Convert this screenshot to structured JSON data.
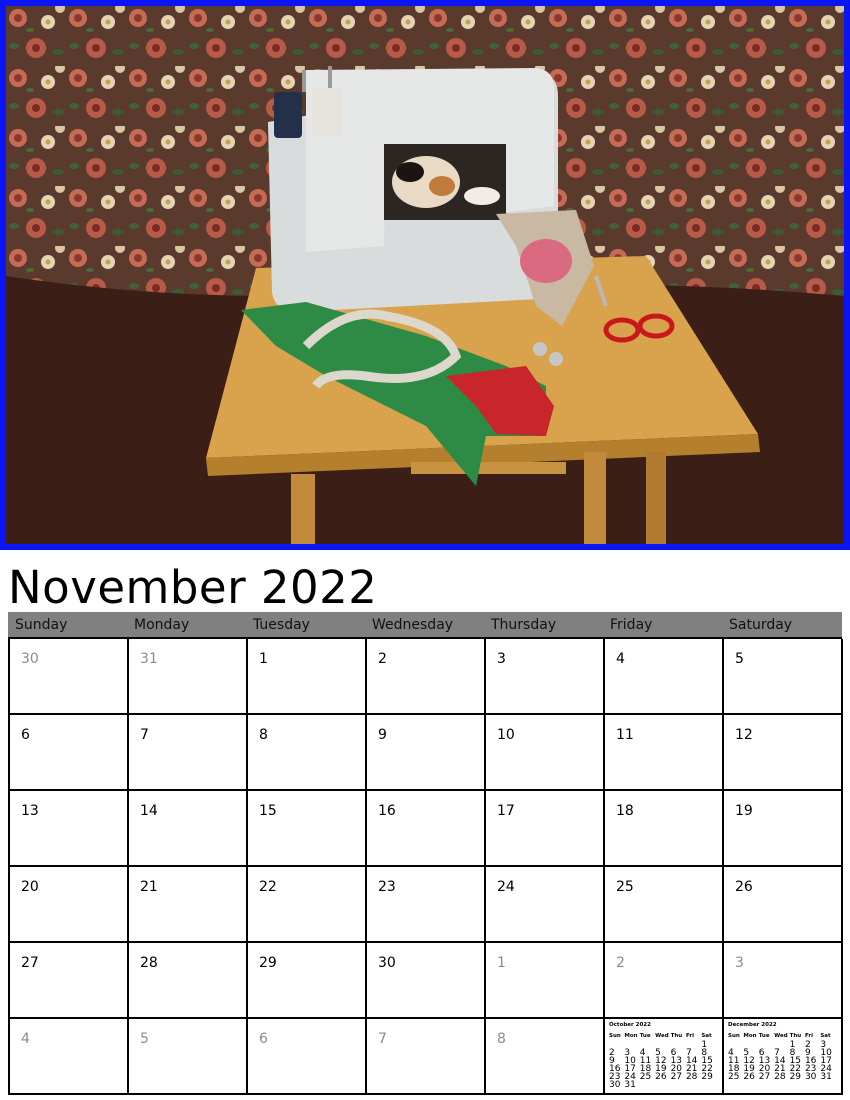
{
  "photo": {
    "frame_color": "#0a14f5"
  },
  "title": "November 2022",
  "weekdays": [
    "Sunday",
    "Monday",
    "Tuesday",
    "Wednesday",
    "Thursday",
    "Friday",
    "Saturday"
  ],
  "days": [
    {
      "label": "30",
      "muted": true
    },
    {
      "label": "31",
      "muted": true
    },
    {
      "label": "1",
      "muted": false
    },
    {
      "label": "2",
      "muted": false
    },
    {
      "label": "3",
      "muted": false
    },
    {
      "label": "4",
      "muted": false
    },
    {
      "label": "5",
      "muted": false
    },
    {
      "label": "6",
      "muted": false
    },
    {
      "label": "7",
      "muted": false
    },
    {
      "label": "8",
      "muted": false
    },
    {
      "label": "9",
      "muted": false
    },
    {
      "label": "10",
      "muted": false
    },
    {
      "label": "11",
      "muted": false
    },
    {
      "label": "12",
      "muted": false
    },
    {
      "label": "13",
      "muted": false
    },
    {
      "label": "14",
      "muted": false
    },
    {
      "label": "15",
      "muted": false
    },
    {
      "label": "16",
      "muted": false
    },
    {
      "label": "17",
      "muted": false
    },
    {
      "label": "18",
      "muted": false
    },
    {
      "label": "19",
      "muted": false
    },
    {
      "label": "20",
      "muted": false
    },
    {
      "label": "21",
      "muted": false
    },
    {
      "label": "22",
      "muted": false
    },
    {
      "label": "23",
      "muted": false
    },
    {
      "label": "24",
      "muted": false
    },
    {
      "label": "25",
      "muted": false
    },
    {
      "label": "26",
      "muted": false
    },
    {
      "label": "27",
      "muted": false
    },
    {
      "label": "28",
      "muted": false
    },
    {
      "label": "29",
      "muted": false
    },
    {
      "label": "30",
      "muted": false
    },
    {
      "label": "1",
      "muted": true
    },
    {
      "label": "2",
      "muted": true
    },
    {
      "label": "3",
      "muted": true
    },
    {
      "label": "4",
      "muted": true
    },
    {
      "label": "5",
      "muted": true
    },
    {
      "label": "6",
      "muted": true
    },
    {
      "label": "7",
      "muted": true
    },
    {
      "label": "8",
      "muted": true
    },
    {
      "mini": "prev"
    },
    {
      "mini": "next"
    }
  ],
  "mini_prev": {
    "title": "October 2022",
    "headers": [
      "Sun",
      "Mon",
      "Tue",
      "Wed",
      "Thu",
      "Fri",
      "Sat"
    ],
    "cells": [
      "",
      "",
      "",
      "",
      "",
      "",
      "1",
      "2",
      "3",
      "4",
      "5",
      "6",
      "7",
      "8",
      "9",
      "10",
      "11",
      "12",
      "13",
      "14",
      "15",
      "16",
      "17",
      "18",
      "19",
      "20",
      "21",
      "22",
      "23",
      "24",
      "25",
      "26",
      "27",
      "28",
      "29",
      "30",
      "31"
    ]
  },
  "mini_next": {
    "title": "December 2022",
    "headers": [
      "Sun",
      "Mon",
      "Tue",
      "Wed",
      "Thu",
      "Fri",
      "Sat"
    ],
    "cells": [
      "",
      "",
      "",
      "",
      "1",
      "2",
      "3",
      "4",
      "5",
      "6",
      "7",
      "8",
      "9",
      "10",
      "11",
      "12",
      "13",
      "14",
      "15",
      "16",
      "17",
      "18",
      "19",
      "20",
      "21",
      "22",
      "23",
      "24",
      "25",
      "26",
      "27",
      "28",
      "29",
      "30",
      "31"
    ]
  },
  "colors": {
    "header_bar": "#808080",
    "muted_day": "#8c8c8c"
  }
}
